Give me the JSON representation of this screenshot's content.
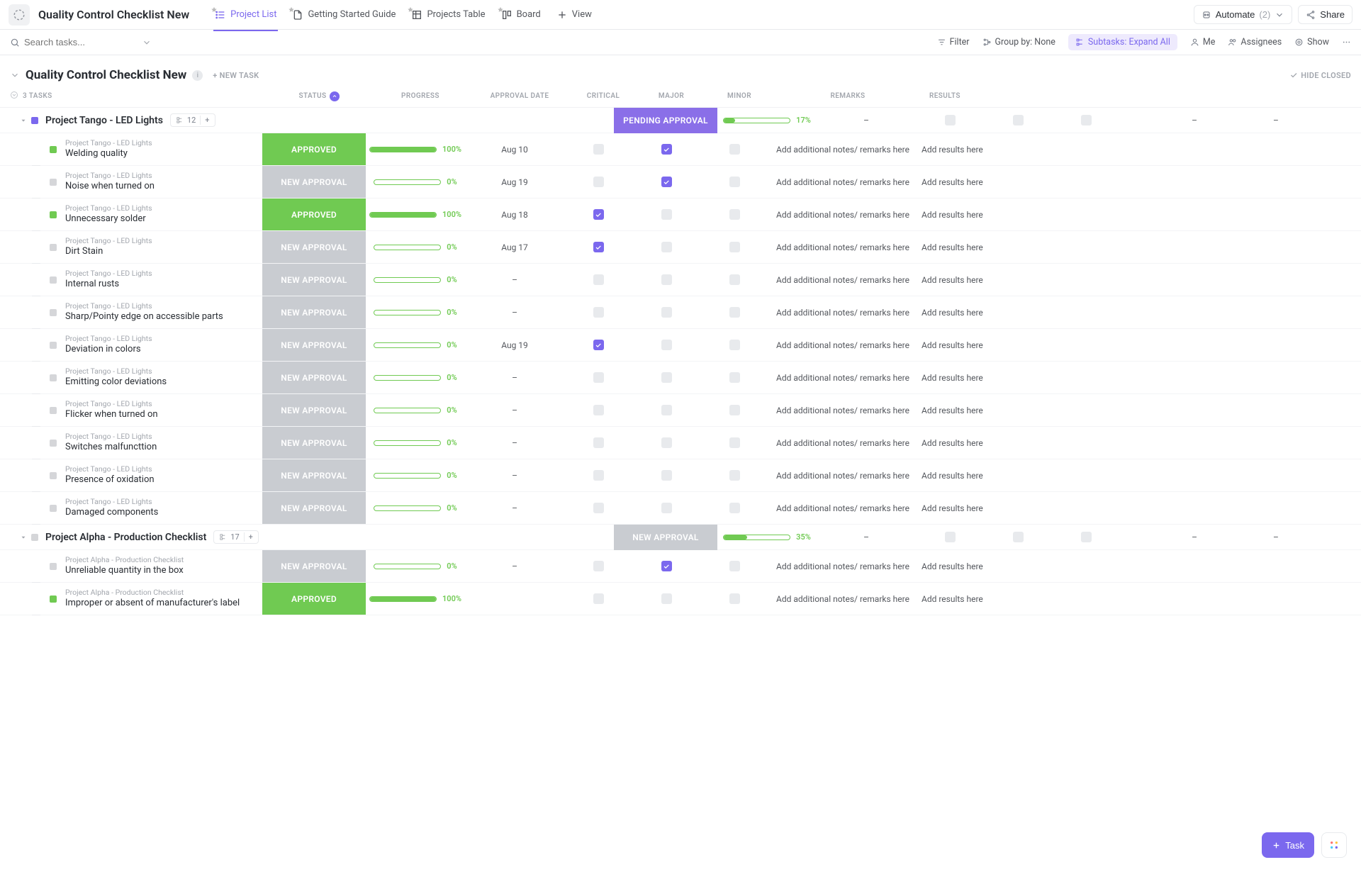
{
  "header": {
    "title": "Quality Control Checklist New",
    "views": [
      {
        "label": "Project List",
        "active": true,
        "icon": "list"
      },
      {
        "label": "Getting Started Guide",
        "active": false,
        "icon": "doc"
      },
      {
        "label": "Projects Table",
        "active": false,
        "icon": "table"
      },
      {
        "label": "Board",
        "active": false,
        "icon": "board"
      },
      {
        "label": "View",
        "active": false,
        "icon": "plus"
      }
    ],
    "automate_label": "Automate",
    "automate_count": "(2)",
    "share_label": "Share"
  },
  "toolbar": {
    "search_placeholder": "Search tasks...",
    "filter": "Filter",
    "group_by": "Group by: None",
    "subtasks": "Subtasks: Expand All",
    "me": "Me",
    "assignees": "Assignees",
    "show": "Show"
  },
  "list": {
    "title": "Quality Control Checklist New",
    "new_task": "+ NEW TASK",
    "hide_closed": "HIDE CLOSED",
    "task_count": "3 TASKS",
    "columns": [
      "STATUS",
      "PROGRESS",
      "APPROVAL DATE",
      "CRITICAL",
      "MAJOR",
      "MINOR",
      "REMARKS",
      "RESULTS"
    ],
    "remarks_placeholder": "Add additional notes/ remarks here",
    "results_placeholder": "Add results here"
  },
  "groups": [
    {
      "name": "Project Tango - LED Lights",
      "count": "12",
      "color": "purple",
      "status": "PENDING APPROVAL",
      "statusClass": "pending",
      "progress": 17,
      "date": "–",
      "remarks": "–",
      "results": "–",
      "tasks": [
        {
          "bc": "Project Tango - LED Lights",
          "name": "Welding quality",
          "status": "APPROVED",
          "sc": "approved",
          "sq": "green",
          "progress": 100,
          "date": "Aug 10",
          "crit": false,
          "major": true,
          "minor": false
        },
        {
          "bc": "Project Tango - LED Lights",
          "name": "Noise when turned on",
          "status": "NEW APPROVAL",
          "sc": "new",
          "sq": "",
          "progress": 0,
          "date": "Aug 19",
          "crit": false,
          "major": true,
          "minor": false
        },
        {
          "bc": "Project Tango - LED Lights",
          "name": "Unnecessary solder",
          "status": "APPROVED",
          "sc": "approved",
          "sq": "green",
          "progress": 100,
          "date": "Aug 18",
          "crit": true,
          "major": false,
          "minor": false
        },
        {
          "bc": "Project Tango - LED Lights",
          "name": "Dirt Stain",
          "status": "NEW APPROVAL",
          "sc": "new",
          "sq": "",
          "progress": 0,
          "date": "Aug 17",
          "crit": true,
          "major": false,
          "minor": false
        },
        {
          "bc": "Project Tango - LED Lights",
          "name": "Internal rusts",
          "status": "NEW APPROVAL",
          "sc": "new",
          "sq": "",
          "progress": 0,
          "date": "–",
          "crit": false,
          "major": false,
          "minor": false
        },
        {
          "bc": "Project Tango - LED Lights",
          "name": "Sharp/Pointy edge on accessible parts",
          "status": "NEW APPROVAL",
          "sc": "new",
          "sq": "",
          "progress": 0,
          "date": "–",
          "crit": false,
          "major": false,
          "minor": false
        },
        {
          "bc": "Project Tango - LED Lights",
          "name": "Deviation in colors",
          "status": "NEW APPROVAL",
          "sc": "new",
          "sq": "",
          "progress": 0,
          "date": "Aug 19",
          "crit": true,
          "major": false,
          "minor": false
        },
        {
          "bc": "Project Tango - LED Lights",
          "name": "Emitting color deviations",
          "status": "NEW APPROVAL",
          "sc": "new",
          "sq": "",
          "progress": 0,
          "date": "–",
          "crit": false,
          "major": false,
          "minor": false
        },
        {
          "bc": "Project Tango - LED Lights",
          "name": "Flicker when turned on",
          "status": "NEW APPROVAL",
          "sc": "new",
          "sq": "",
          "progress": 0,
          "date": "–",
          "crit": false,
          "major": false,
          "minor": false
        },
        {
          "bc": "Project Tango - LED Lights",
          "name": "Switches malfuncttion",
          "status": "NEW APPROVAL",
          "sc": "new",
          "sq": "",
          "progress": 0,
          "date": "–",
          "crit": false,
          "major": false,
          "minor": false
        },
        {
          "bc": "Project Tango - LED Lights",
          "name": "Presence of oxidation",
          "status": "NEW APPROVAL",
          "sc": "new",
          "sq": "",
          "progress": 0,
          "date": "–",
          "crit": false,
          "major": false,
          "minor": false
        },
        {
          "bc": "Project Tango - LED Lights",
          "name": "Damaged components",
          "status": "NEW APPROVAL",
          "sc": "new",
          "sq": "",
          "progress": 0,
          "date": "–",
          "crit": false,
          "major": false,
          "minor": false
        }
      ]
    },
    {
      "name": "Project Alpha - Production Checklist",
      "count": "17",
      "color": "grey",
      "status": "NEW APPROVAL",
      "statusClass": "new",
      "progress": 35,
      "date": "–",
      "remarks": "–",
      "results": "–",
      "tasks": [
        {
          "bc": "Project Alpha - Production Checklist",
          "name": "Unreliable quantity in the box",
          "status": "NEW APPROVAL",
          "sc": "new",
          "sq": "",
          "progress": 0,
          "date": "–",
          "crit": false,
          "major": true,
          "minor": false
        },
        {
          "bc": "Project Alpha - Production Checklist",
          "name": "Improper or absent of manufacturer's label",
          "status": "APPROVED",
          "sc": "approved",
          "sq": "green",
          "progress": 100,
          "date": "",
          "crit": false,
          "major": false,
          "minor": false
        }
      ]
    }
  ],
  "fab": {
    "task": "Task"
  }
}
